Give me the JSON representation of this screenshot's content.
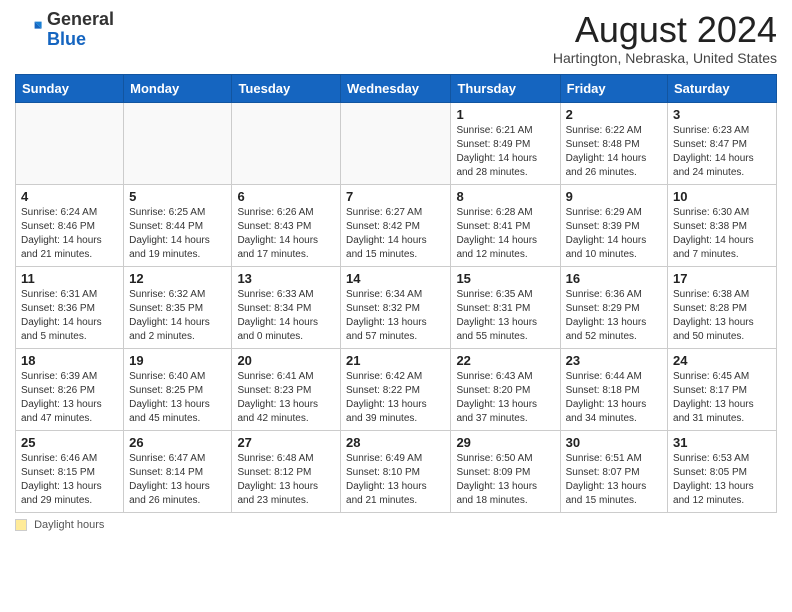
{
  "header": {
    "logo_general": "General",
    "logo_blue": "Blue",
    "month_title": "August 2024",
    "location": "Hartington, Nebraska, United States"
  },
  "weekdays": [
    "Sunday",
    "Monday",
    "Tuesday",
    "Wednesday",
    "Thursday",
    "Friday",
    "Saturday"
  ],
  "footer": {
    "daylight_label": "Daylight hours"
  },
  "weeks": [
    [
      {
        "day": "",
        "info": ""
      },
      {
        "day": "",
        "info": ""
      },
      {
        "day": "",
        "info": ""
      },
      {
        "day": "",
        "info": ""
      },
      {
        "day": "1",
        "info": "Sunrise: 6:21 AM\nSunset: 8:49 PM\nDaylight: 14 hours and 28 minutes."
      },
      {
        "day": "2",
        "info": "Sunrise: 6:22 AM\nSunset: 8:48 PM\nDaylight: 14 hours and 26 minutes."
      },
      {
        "day": "3",
        "info": "Sunrise: 6:23 AM\nSunset: 8:47 PM\nDaylight: 14 hours and 24 minutes."
      }
    ],
    [
      {
        "day": "4",
        "info": "Sunrise: 6:24 AM\nSunset: 8:46 PM\nDaylight: 14 hours and 21 minutes."
      },
      {
        "day": "5",
        "info": "Sunrise: 6:25 AM\nSunset: 8:44 PM\nDaylight: 14 hours and 19 minutes."
      },
      {
        "day": "6",
        "info": "Sunrise: 6:26 AM\nSunset: 8:43 PM\nDaylight: 14 hours and 17 minutes."
      },
      {
        "day": "7",
        "info": "Sunrise: 6:27 AM\nSunset: 8:42 PM\nDaylight: 14 hours and 15 minutes."
      },
      {
        "day": "8",
        "info": "Sunrise: 6:28 AM\nSunset: 8:41 PM\nDaylight: 14 hours and 12 minutes."
      },
      {
        "day": "9",
        "info": "Sunrise: 6:29 AM\nSunset: 8:39 PM\nDaylight: 14 hours and 10 minutes."
      },
      {
        "day": "10",
        "info": "Sunrise: 6:30 AM\nSunset: 8:38 PM\nDaylight: 14 hours and 7 minutes."
      }
    ],
    [
      {
        "day": "11",
        "info": "Sunrise: 6:31 AM\nSunset: 8:36 PM\nDaylight: 14 hours and 5 minutes."
      },
      {
        "day": "12",
        "info": "Sunrise: 6:32 AM\nSunset: 8:35 PM\nDaylight: 14 hours and 2 minutes."
      },
      {
        "day": "13",
        "info": "Sunrise: 6:33 AM\nSunset: 8:34 PM\nDaylight: 14 hours and 0 minutes."
      },
      {
        "day": "14",
        "info": "Sunrise: 6:34 AM\nSunset: 8:32 PM\nDaylight: 13 hours and 57 minutes."
      },
      {
        "day": "15",
        "info": "Sunrise: 6:35 AM\nSunset: 8:31 PM\nDaylight: 13 hours and 55 minutes."
      },
      {
        "day": "16",
        "info": "Sunrise: 6:36 AM\nSunset: 8:29 PM\nDaylight: 13 hours and 52 minutes."
      },
      {
        "day": "17",
        "info": "Sunrise: 6:38 AM\nSunset: 8:28 PM\nDaylight: 13 hours and 50 minutes."
      }
    ],
    [
      {
        "day": "18",
        "info": "Sunrise: 6:39 AM\nSunset: 8:26 PM\nDaylight: 13 hours and 47 minutes."
      },
      {
        "day": "19",
        "info": "Sunrise: 6:40 AM\nSunset: 8:25 PM\nDaylight: 13 hours and 45 minutes."
      },
      {
        "day": "20",
        "info": "Sunrise: 6:41 AM\nSunset: 8:23 PM\nDaylight: 13 hours and 42 minutes."
      },
      {
        "day": "21",
        "info": "Sunrise: 6:42 AM\nSunset: 8:22 PM\nDaylight: 13 hours and 39 minutes."
      },
      {
        "day": "22",
        "info": "Sunrise: 6:43 AM\nSunset: 8:20 PM\nDaylight: 13 hours and 37 minutes."
      },
      {
        "day": "23",
        "info": "Sunrise: 6:44 AM\nSunset: 8:18 PM\nDaylight: 13 hours and 34 minutes."
      },
      {
        "day": "24",
        "info": "Sunrise: 6:45 AM\nSunset: 8:17 PM\nDaylight: 13 hours and 31 minutes."
      }
    ],
    [
      {
        "day": "25",
        "info": "Sunrise: 6:46 AM\nSunset: 8:15 PM\nDaylight: 13 hours and 29 minutes."
      },
      {
        "day": "26",
        "info": "Sunrise: 6:47 AM\nSunset: 8:14 PM\nDaylight: 13 hours and 26 minutes."
      },
      {
        "day": "27",
        "info": "Sunrise: 6:48 AM\nSunset: 8:12 PM\nDaylight: 13 hours and 23 minutes."
      },
      {
        "day": "28",
        "info": "Sunrise: 6:49 AM\nSunset: 8:10 PM\nDaylight: 13 hours and 21 minutes."
      },
      {
        "day": "29",
        "info": "Sunrise: 6:50 AM\nSunset: 8:09 PM\nDaylight: 13 hours and 18 minutes."
      },
      {
        "day": "30",
        "info": "Sunrise: 6:51 AM\nSunset: 8:07 PM\nDaylight: 13 hours and 15 minutes."
      },
      {
        "day": "31",
        "info": "Sunrise: 6:53 AM\nSunset: 8:05 PM\nDaylight: 13 hours and 12 minutes."
      }
    ]
  ]
}
